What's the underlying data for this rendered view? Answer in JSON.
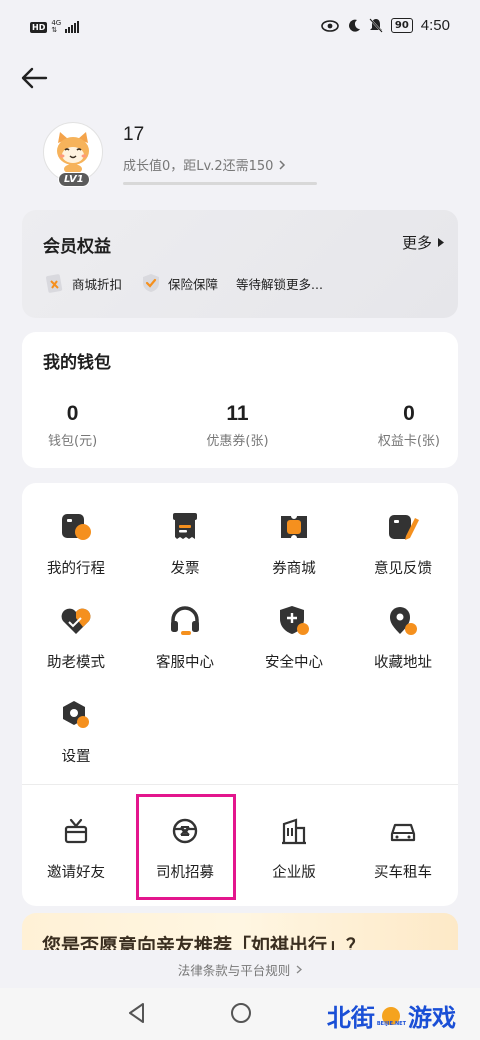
{
  "status_bar": {
    "hd": "HD",
    "network_top": "4G",
    "network_bottom": "⇅",
    "battery": "90",
    "time": "4:50"
  },
  "profile": {
    "username": "17",
    "level_badge": "LV1",
    "growth_text": "成长值0，距Lv.2还需150",
    "growth_progress": 0
  },
  "benefits": {
    "title": "会员权益",
    "more": "更多",
    "items": [
      {
        "label": "商城折扣",
        "icon": "shop-discount-icon"
      },
      {
        "label": "保险保障",
        "icon": "insurance-shield-icon"
      },
      {
        "label": "等待解锁更多..."
      }
    ]
  },
  "wallet": {
    "title": "我的钱包",
    "stats": [
      {
        "value": "0",
        "label": "钱包(元)"
      },
      {
        "value": "11",
        "label": "优惠券(张)"
      },
      {
        "value": "0",
        "label": "权益卡(张)"
      }
    ]
  },
  "services": {
    "items": [
      {
        "label": "我的行程",
        "icon": "trip-icon"
      },
      {
        "label": "发票",
        "icon": "invoice-icon"
      },
      {
        "label": "券商城",
        "icon": "coupon-mall-icon"
      },
      {
        "label": "意见反馈",
        "icon": "feedback-icon"
      },
      {
        "label": "助老模式",
        "icon": "elderly-mode-icon"
      },
      {
        "label": "客服中心",
        "icon": "headset-icon"
      },
      {
        "label": "安全中心",
        "icon": "safety-shield-icon"
      },
      {
        "label": "收藏地址",
        "icon": "location-pin-icon"
      },
      {
        "label": "设置",
        "icon": "settings-icon"
      }
    ],
    "secondary": [
      {
        "label": "邀请好友",
        "icon": "gift-icon"
      },
      {
        "label": "司机招募",
        "icon": "steering-wheel-icon"
      },
      {
        "label": "企业版",
        "icon": "building-icon"
      },
      {
        "label": "买车租车",
        "icon": "car-icon"
      }
    ]
  },
  "promo": {
    "text": "您是否愿意向亲友推荐「如祺出行」？"
  },
  "legal": {
    "text": "法律条款与平台规则"
  },
  "watermark": {
    "text_a": "北街",
    "text_b": "游戏",
    "small": "BEIJIE.NET"
  },
  "colors": {
    "accent": "#f5901e",
    "dark_icon": "#333333",
    "highlight": "#e3168d"
  }
}
